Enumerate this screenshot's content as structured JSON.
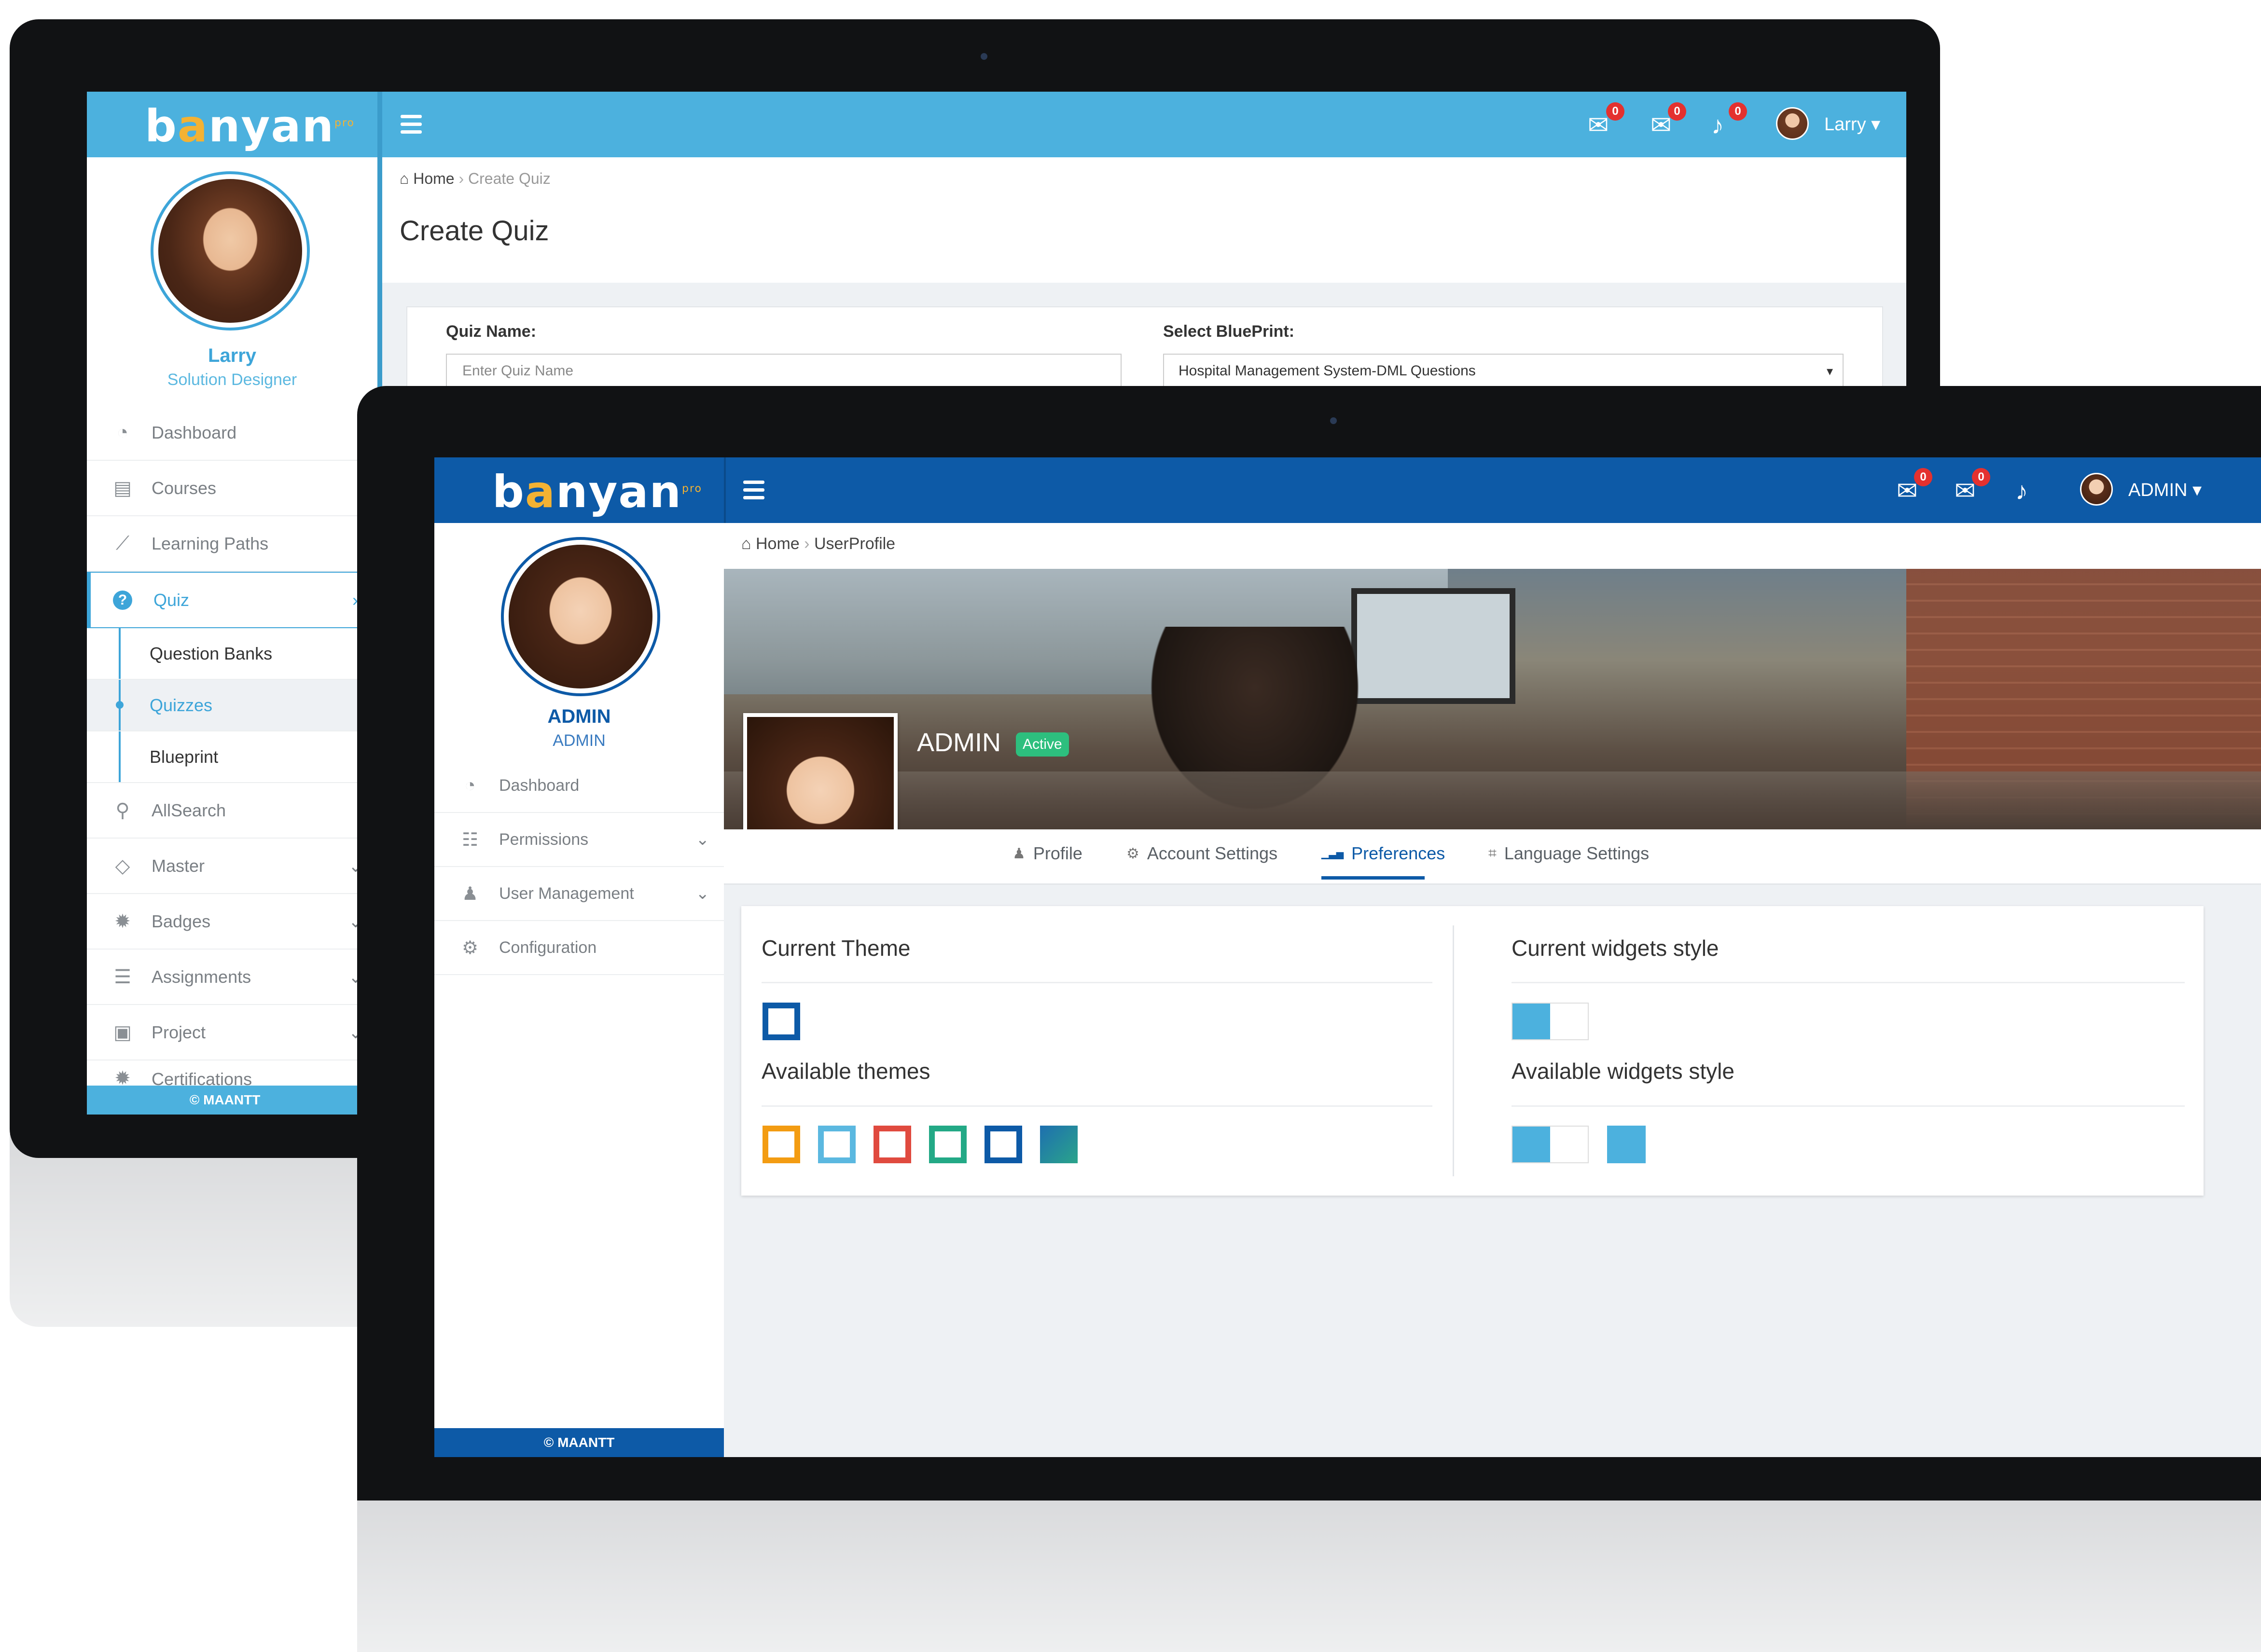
{
  "back_screen": {
    "brand": {
      "name_part1": "b",
      "name_accent": "a",
      "name_part2": "nyan",
      "superscript": "pro"
    },
    "header": {
      "icons": [
        {
          "name": "chat-icon",
          "badge": "0"
        },
        {
          "name": "mail-icon",
          "badge": "0"
        },
        {
          "name": "bell-icon",
          "badge": "0"
        }
      ],
      "user_name": "Larry",
      "caret": "▾"
    },
    "profile": {
      "name": "Larry",
      "role": "Solution Designer"
    },
    "sidebar": {
      "items": [
        {
          "label": "Dashboard",
          "icon": "dashboard-icon",
          "glyph": "◔"
        },
        {
          "label": "Courses",
          "icon": "book-icon",
          "glyph": "▤"
        },
        {
          "label": "Learning Paths",
          "icon": "chart-line-icon",
          "glyph": "⟋"
        },
        {
          "label": "Quiz",
          "icon": "question-icon",
          "glyph": "?",
          "chevron": "›"
        },
        {
          "label": "Question Banks"
        },
        {
          "label": "Quizzes"
        },
        {
          "label": "Blueprint"
        },
        {
          "label": "AllSearch",
          "icon": "search-icon",
          "glyph": "⚲"
        },
        {
          "label": "Master",
          "icon": "diamond-icon",
          "glyph": "◇",
          "chevron": "⌄"
        },
        {
          "label": "Badges",
          "icon": "badge-icon",
          "glyph": "✹",
          "chevron": "⌄"
        },
        {
          "label": "Assignments",
          "icon": "list-icon",
          "glyph": "☰",
          "chevron": "⌄"
        },
        {
          "label": "Project",
          "icon": "project-icon",
          "glyph": "▣",
          "chevron": "⌄"
        },
        {
          "label": "Certifications",
          "icon": "certificate-icon",
          "glyph": "✹"
        }
      ],
      "footer": "© MAANTT"
    },
    "breadcrumb": {
      "home": "Home",
      "separator": "›",
      "current": "Create Quiz"
    },
    "page_title": "Create Quiz",
    "form": {
      "quiz_name_label": "Quiz Name:",
      "quiz_name_placeholder": "Enter Quiz Name",
      "blueprint_label": "Select BluePrint:",
      "blueprint_value": "Hospital Management System-DML Questions",
      "blueprint_caret": "▾"
    },
    "colors": {
      "header": "#4cb1de",
      "accent": "#3da5d9"
    }
  },
  "front_screen": {
    "brand": {
      "name_part1": "b",
      "name_accent": "a",
      "name_part2": "nyan",
      "superscript": "pro"
    },
    "header": {
      "icons": [
        {
          "name": "chat-icon",
          "badge": "0"
        },
        {
          "name": "mail-icon",
          "badge": "0"
        },
        {
          "name": "bell-icon"
        }
      ],
      "user_name": "ADMIN",
      "caret": "▾"
    },
    "profile": {
      "name": "ADMIN",
      "role": "ADMIN"
    },
    "sidebar": {
      "items": [
        {
          "label": "Dashboard",
          "icon": "dashboard-icon",
          "glyph": "◔"
        },
        {
          "label": "Permissions",
          "icon": "sliders-icon",
          "glyph": "☷",
          "chevron": "⌄"
        },
        {
          "label": "User Management",
          "icon": "users-icon",
          "glyph": "♟",
          "chevron": "⌄"
        },
        {
          "label": "Configuration",
          "icon": "gears-icon",
          "glyph": "⚙"
        }
      ],
      "footer": "© MAANTT"
    },
    "breadcrumb": {
      "home": "Home",
      "separator": "›",
      "current": "UserProfile"
    },
    "cover": {
      "name": "ADMIN",
      "status": "Active"
    },
    "tabs": [
      {
        "label": "Profile",
        "icon": "user-icon",
        "glyph": "♟"
      },
      {
        "label": "Account Settings",
        "icon": "gear-icon",
        "glyph": "⚙"
      },
      {
        "label": "Preferences",
        "icon": "bar-chart-icon",
        "glyph": "▁▃▅"
      },
      {
        "label": "Language Settings",
        "icon": "language-icon",
        "glyph": "⌗"
      }
    ],
    "active_tab": "Preferences",
    "preferences": {
      "current_theme_title": "Current Theme",
      "available_themes_title": "Available themes",
      "current_widgets_title": "Current widgets style",
      "available_widgets_title": "Available widgets style",
      "current_theme_color": "#0d5aa7",
      "themes": [
        "#f39c12",
        "#5bb8e0",
        "#e04a3f",
        "#23a986",
        "#0d5aa7",
        "gradient-teal-blue"
      ]
    },
    "colors": {
      "header": "#0d5aa7",
      "accent": "#0d5aa7"
    }
  }
}
